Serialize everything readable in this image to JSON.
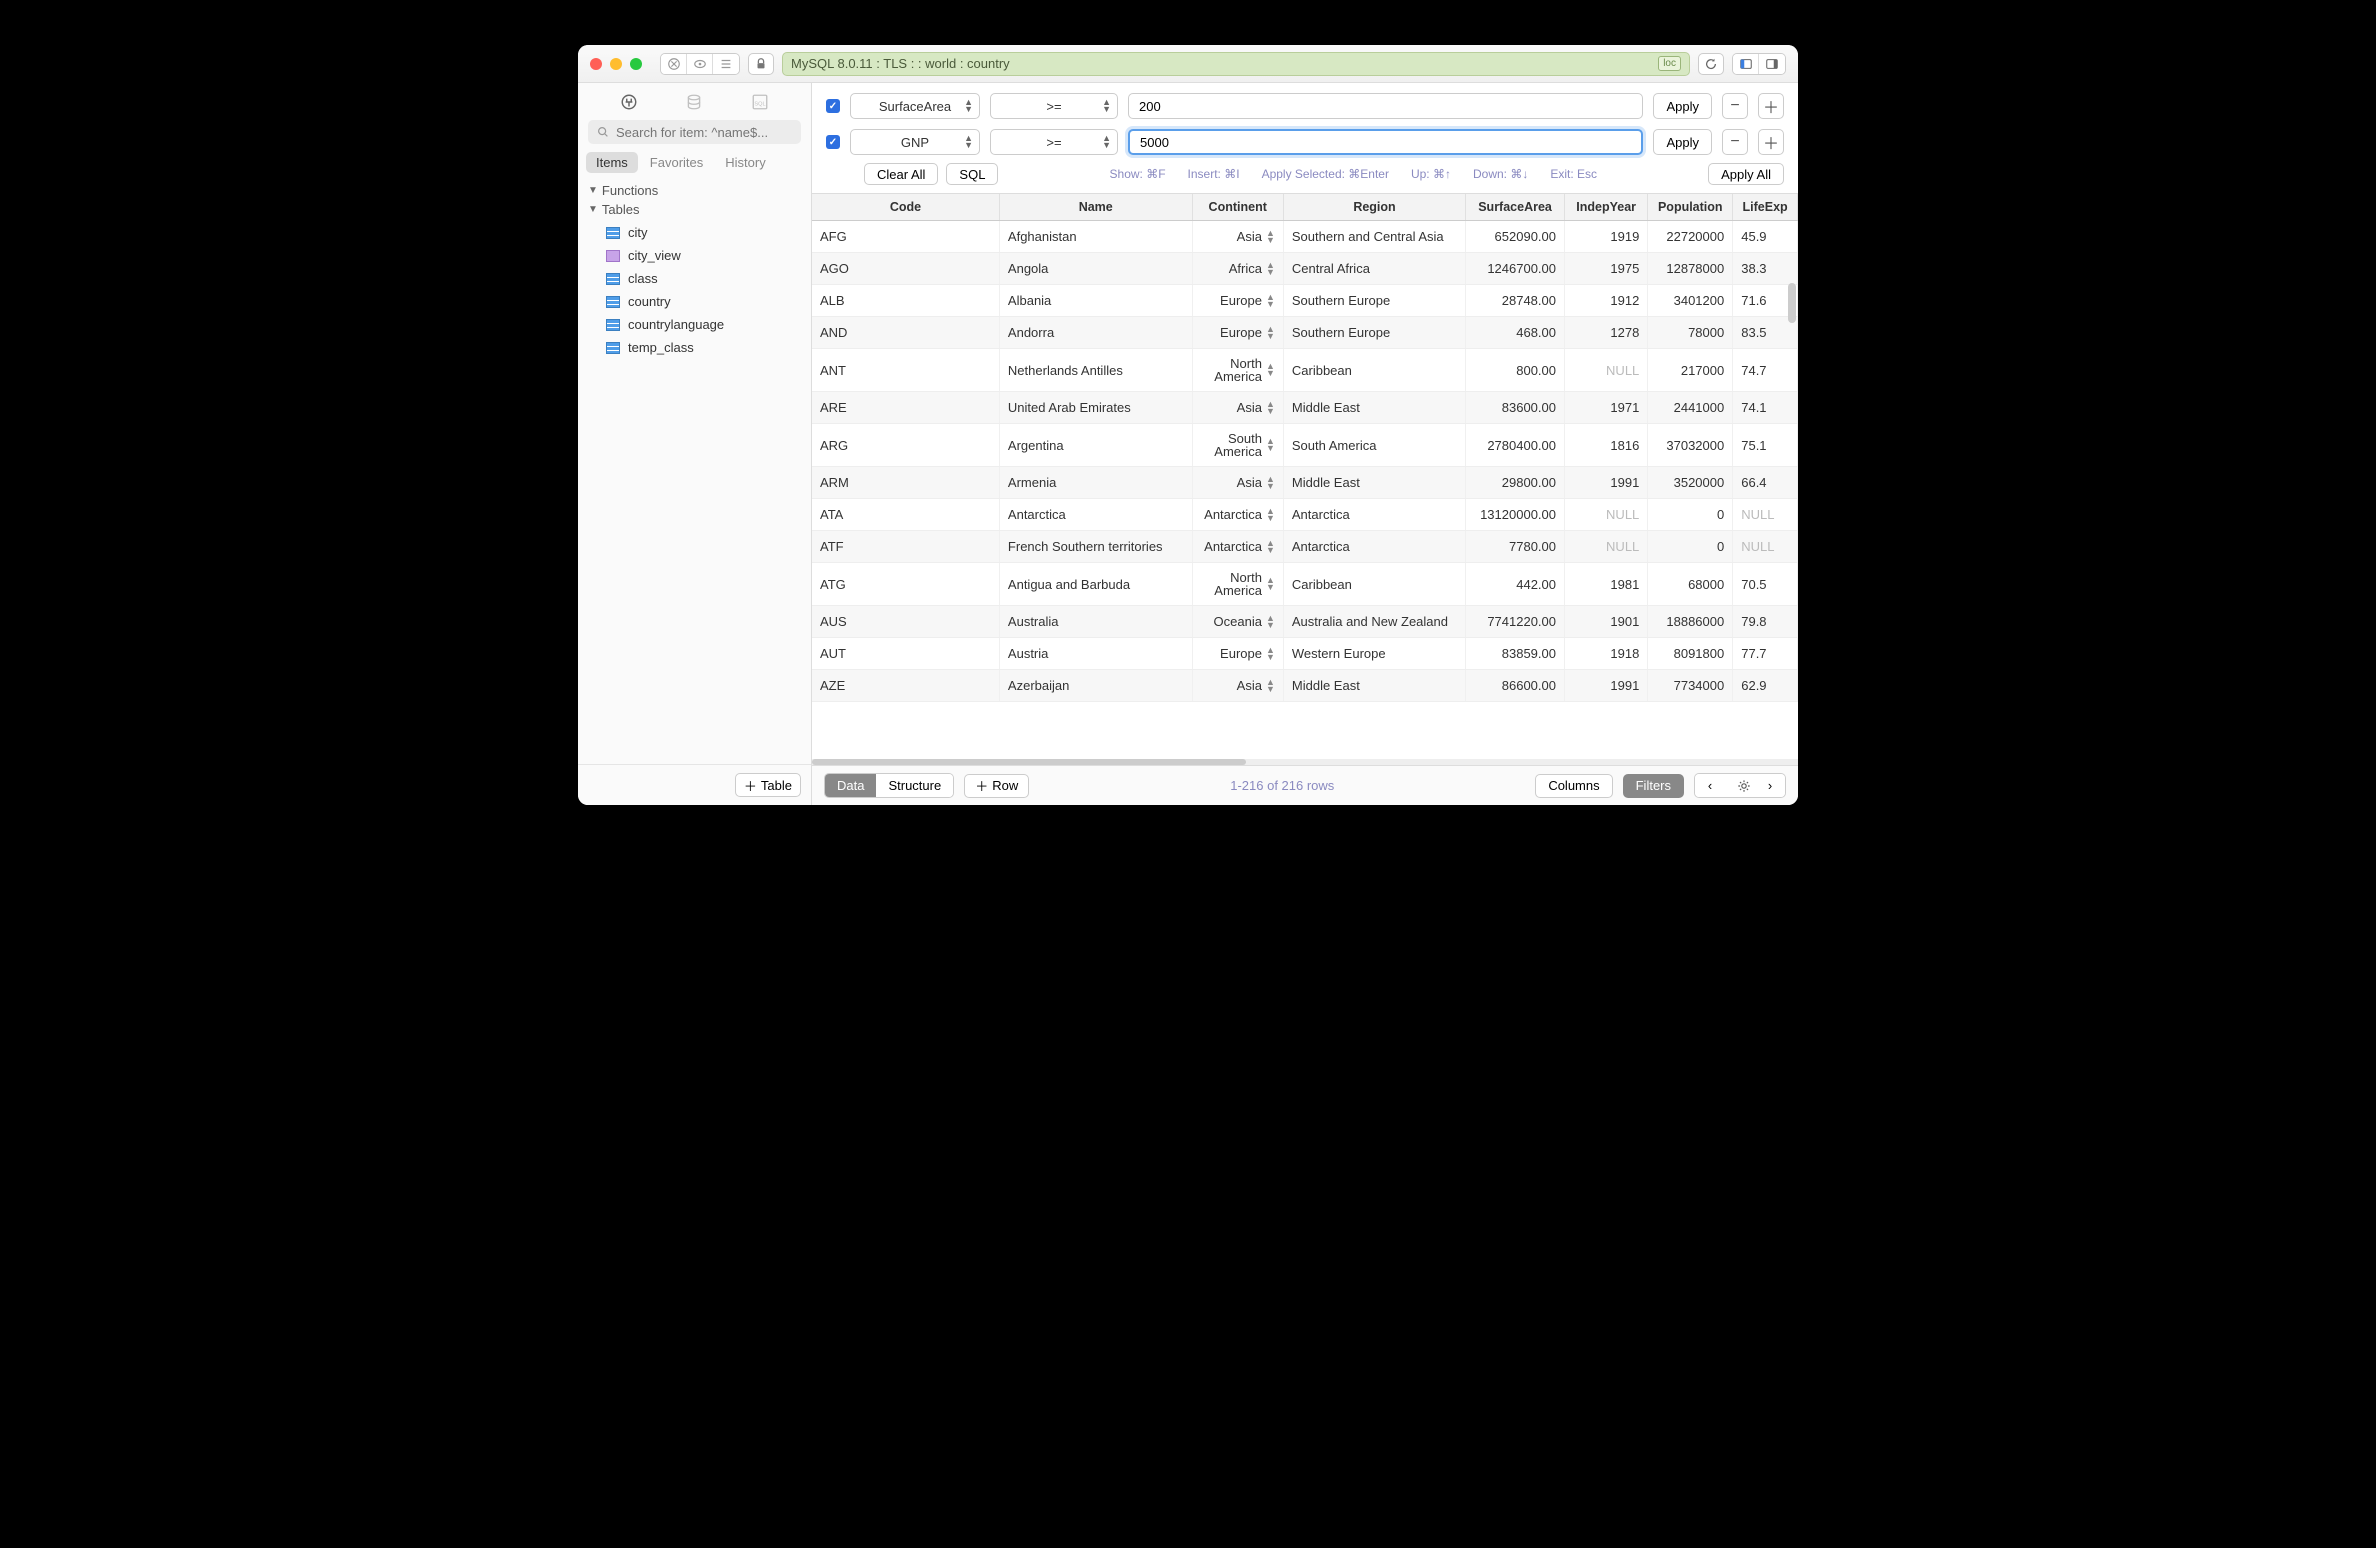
{
  "titlebar": {
    "connection": "MySQL 8.0.11 : TLS :  : world : country",
    "loc_badge": "loc"
  },
  "sidebar": {
    "search_placeholder": "Search for item: ^name$...",
    "tabs": [
      "Items",
      "Favorites",
      "History"
    ],
    "active_tab": 0,
    "sections": {
      "functions": "Functions",
      "tables": "Tables"
    },
    "tables": [
      {
        "name": "city",
        "kind": "table"
      },
      {
        "name": "city_view",
        "kind": "view"
      },
      {
        "name": "class",
        "kind": "table"
      },
      {
        "name": "country",
        "kind": "table"
      },
      {
        "name": "countrylanguage",
        "kind": "table"
      },
      {
        "name": "temp_class",
        "kind": "table"
      }
    ],
    "add_table_btn": "Table"
  },
  "filters": {
    "rows": [
      {
        "checked": true,
        "column": "SurfaceArea",
        "op": ">=",
        "value": "200",
        "focused": false
      },
      {
        "checked": true,
        "column": "GNP",
        "op": ">=",
        "value": "5000",
        "focused": true
      }
    ],
    "apply_btn": "Apply",
    "clear_all_btn": "Clear All",
    "sql_btn": "SQL",
    "apply_all_btn": "Apply All",
    "hints": {
      "show": "Show: ⌘F",
      "insert": "Insert: ⌘I",
      "apply_selected": "Apply Selected: ⌘Enter",
      "up": "Up: ⌘↑",
      "down": "Down: ⌘↓",
      "exit": "Exit: Esc"
    }
  },
  "table": {
    "columns": [
      "Code",
      "Name",
      "Continent",
      "Region",
      "SurfaceArea",
      "IndepYear",
      "Population",
      "LifeExp"
    ],
    "rows": [
      {
        "Code": "AFG",
        "Name": "Afghanistan",
        "Continent": "Asia",
        "Region": "Southern and Central Asia",
        "SurfaceArea": "652090.00",
        "IndepYear": "1919",
        "Population": "22720000",
        "LifeExp": "45.9"
      },
      {
        "Code": "AGO",
        "Name": "Angola",
        "Continent": "Africa",
        "Region": "Central Africa",
        "SurfaceArea": "1246700.00",
        "IndepYear": "1975",
        "Population": "12878000",
        "LifeExp": "38.3"
      },
      {
        "Code": "ALB",
        "Name": "Albania",
        "Continent": "Europe",
        "Region": "Southern Europe",
        "SurfaceArea": "28748.00",
        "IndepYear": "1912",
        "Population": "3401200",
        "LifeExp": "71.6"
      },
      {
        "Code": "AND",
        "Name": "Andorra",
        "Continent": "Europe",
        "Region": "Southern Europe",
        "SurfaceArea": "468.00",
        "IndepYear": "1278",
        "Population": "78000",
        "LifeExp": "83.5"
      },
      {
        "Code": "ANT",
        "Name": "Netherlands Antilles",
        "Continent": "North America",
        "Region": "Caribbean",
        "SurfaceArea": "800.00",
        "IndepYear": "NULL",
        "Population": "217000",
        "LifeExp": "74.7"
      },
      {
        "Code": "ARE",
        "Name": "United Arab Emirates",
        "Continent": "Asia",
        "Region": "Middle East",
        "SurfaceArea": "83600.00",
        "IndepYear": "1971",
        "Population": "2441000",
        "LifeExp": "74.1"
      },
      {
        "Code": "ARG",
        "Name": "Argentina",
        "Continent": "South America",
        "Region": "South America",
        "SurfaceArea": "2780400.00",
        "IndepYear": "1816",
        "Population": "37032000",
        "LifeExp": "75.1"
      },
      {
        "Code": "ARM",
        "Name": "Armenia",
        "Continent": "Asia",
        "Region": "Middle East",
        "SurfaceArea": "29800.00",
        "IndepYear": "1991",
        "Population": "3520000",
        "LifeExp": "66.4"
      },
      {
        "Code": "ATA",
        "Name": "Antarctica",
        "Continent": "Antarctica",
        "Region": "Antarctica",
        "SurfaceArea": "13120000.00",
        "IndepYear": "NULL",
        "Population": "0",
        "LifeExp": "NULL"
      },
      {
        "Code": "ATF",
        "Name": "French Southern territories",
        "Continent": "Antarctica",
        "Region": "Antarctica",
        "SurfaceArea": "7780.00",
        "IndepYear": "NULL",
        "Population": "0",
        "LifeExp": "NULL"
      },
      {
        "Code": "ATG",
        "Name": "Antigua and Barbuda",
        "Continent": "North America",
        "Region": "Caribbean",
        "SurfaceArea": "442.00",
        "IndepYear": "1981",
        "Population": "68000",
        "LifeExp": "70.5"
      },
      {
        "Code": "AUS",
        "Name": "Australia",
        "Continent": "Oceania",
        "Region": "Australia and New Zealand",
        "SurfaceArea": "7741220.00",
        "IndepYear": "1901",
        "Population": "18886000",
        "LifeExp": "79.8"
      },
      {
        "Code": "AUT",
        "Name": "Austria",
        "Continent": "Europe",
        "Region": "Western Europe",
        "SurfaceArea": "83859.00",
        "IndepYear": "1918",
        "Population": "8091800",
        "LifeExp": "77.7"
      },
      {
        "Code": "AZE",
        "Name": "Azerbaijan",
        "Continent": "Asia",
        "Region": "Middle East",
        "SurfaceArea": "86600.00",
        "IndepYear": "1991",
        "Population": "7734000",
        "LifeExp": "62.9"
      }
    ]
  },
  "footer": {
    "data_tab": "Data",
    "structure_tab": "Structure",
    "row_btn": "Row",
    "pager": "1-216 of 216 rows",
    "columns_btn": "Columns",
    "filters_btn": "Filters"
  }
}
